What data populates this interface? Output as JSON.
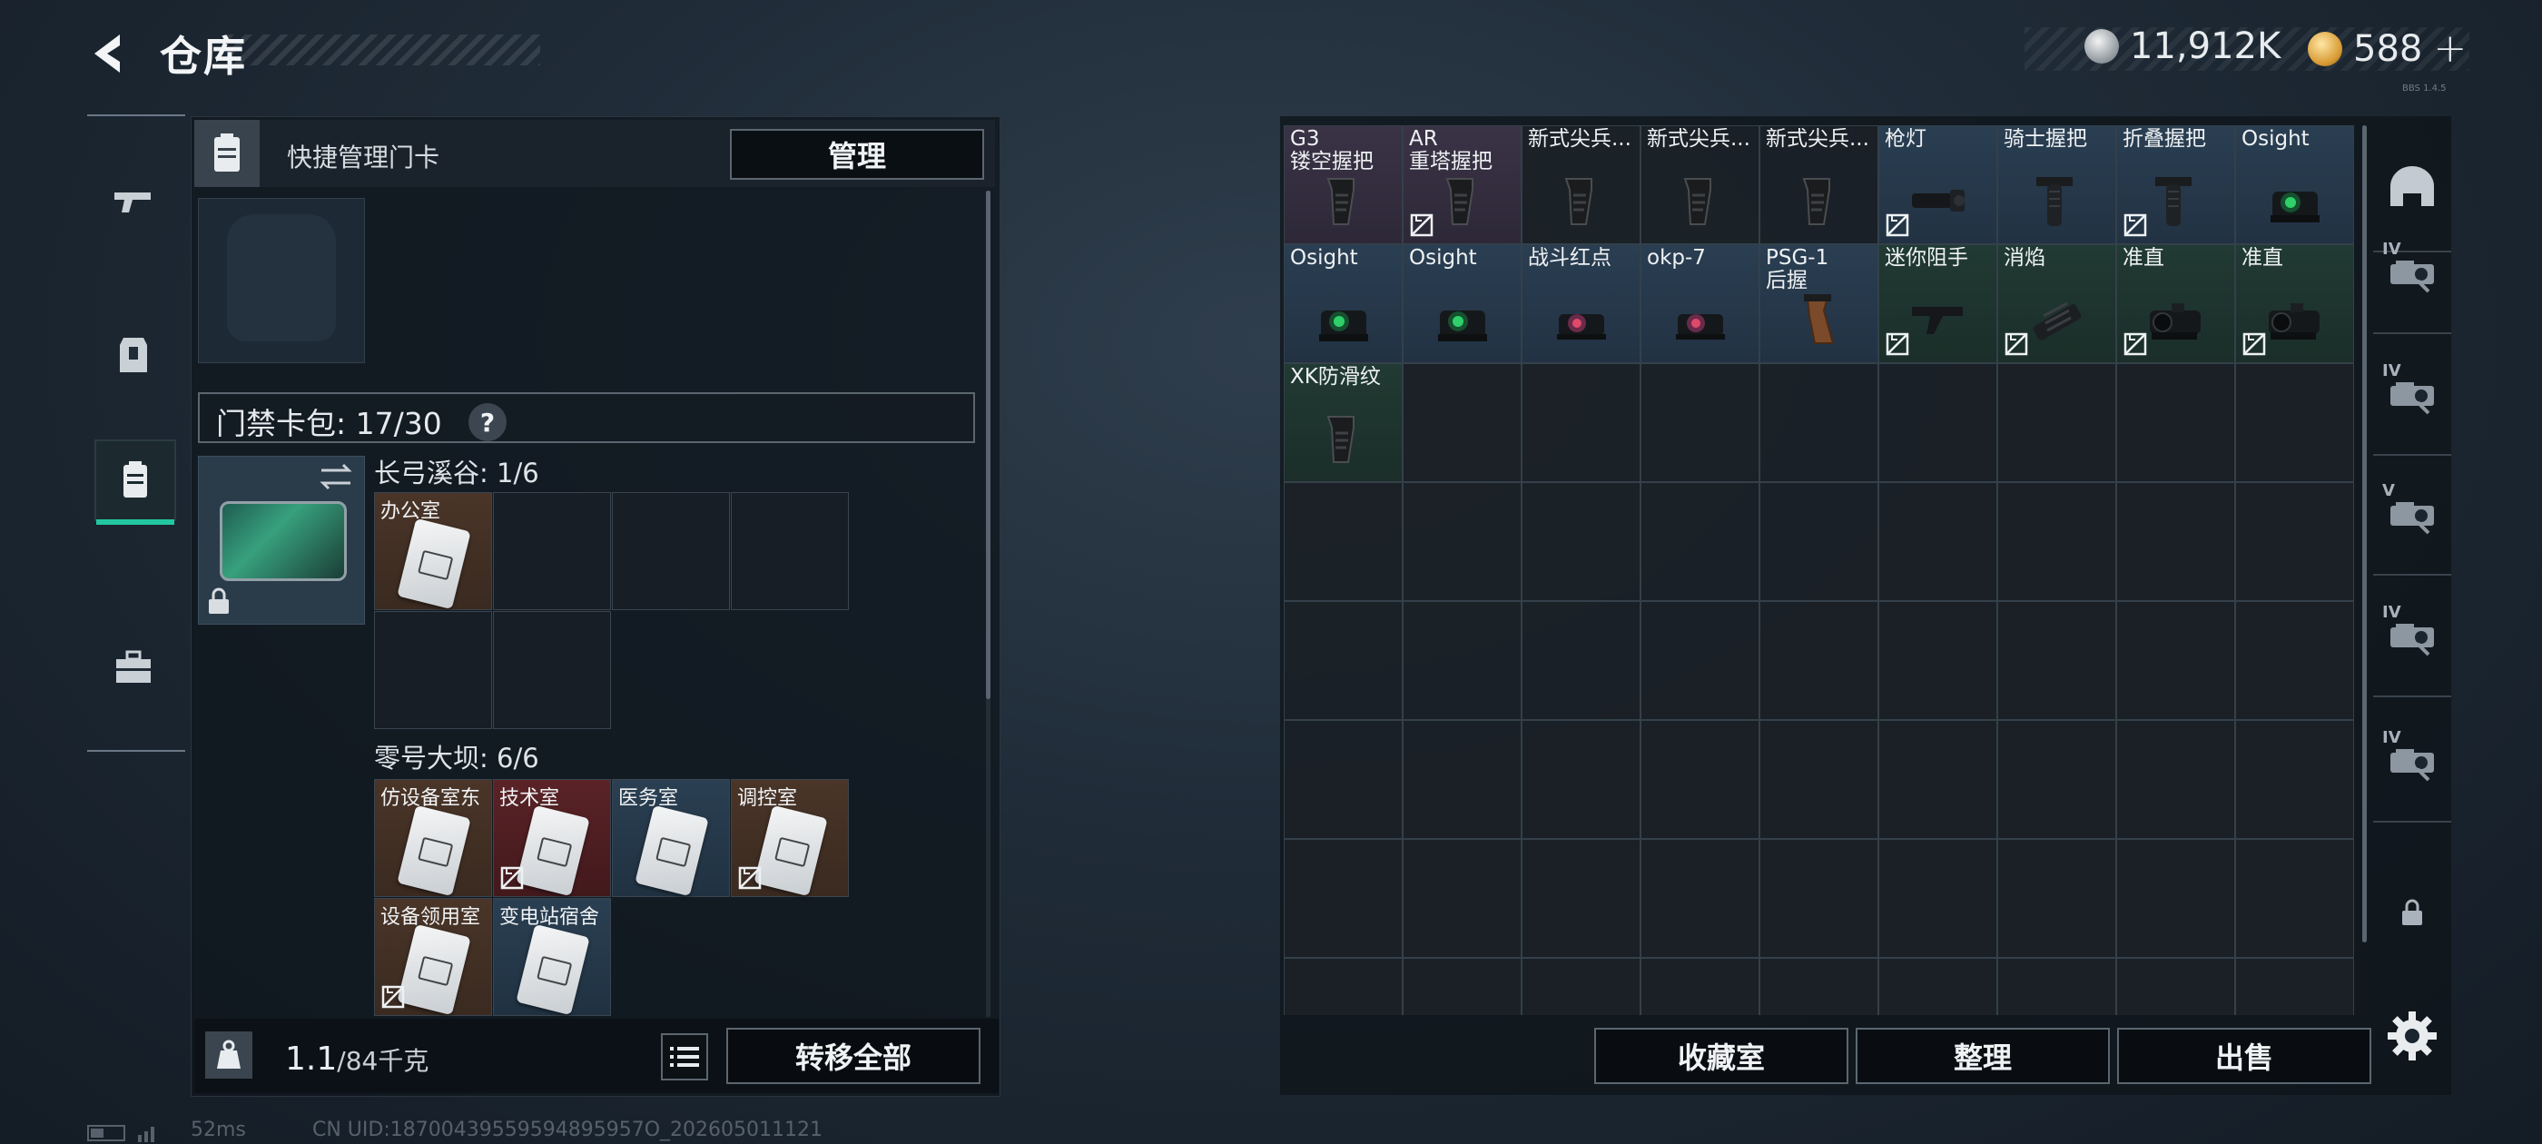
{
  "header": {
    "title": "仓库",
    "currency": [
      {
        "icon": "silver-coin-icon",
        "value": "11,912K"
      },
      {
        "icon": "gold-coin-icon",
        "value": "588",
        "suffix": "+"
      }
    ]
  },
  "left_nav": [
    {
      "icon": "gun-icon",
      "active": false
    },
    {
      "icon": "armor-icon",
      "active": false
    },
    {
      "icon": "keycard-bag-icon",
      "active": true
    },
    {
      "icon": "toolbox-icon",
      "active": false
    }
  ],
  "left_panel": {
    "quick_manage_label": "快捷管理门卡",
    "manage_button": "管理",
    "card_pack_label": "门禁卡包: 17/30",
    "help": "?",
    "sections": [
      {
        "title": "长弓溪谷: 1/6",
        "slots": [
          {
            "label": "办公室",
            "color": "brown",
            "has_card": true,
            "non_tradeable": false
          },
          {
            "label": "",
            "color": "empty"
          },
          {
            "label": "",
            "color": "empty"
          },
          {
            "label": "",
            "color": "empty"
          },
          {
            "label": "",
            "color": "empty"
          },
          {
            "label": "",
            "color": "empty"
          }
        ]
      },
      {
        "title": "零号大坝: 6/6",
        "slots": [
          {
            "label": "仿设备室东",
            "color": "brown",
            "has_card": true,
            "non_tradeable": false
          },
          {
            "label": "技术室",
            "color": "red",
            "has_card": true,
            "non_tradeable": true
          },
          {
            "label": "医务室",
            "color": "blue",
            "has_card": true,
            "non_tradeable": false
          },
          {
            "label": "调控室",
            "color": "brown",
            "has_card": true,
            "non_tradeable": true
          },
          {
            "label": "设备领用室",
            "color": "brown",
            "has_card": true,
            "non_tradeable": true
          },
          {
            "label": "变电站宿舍",
            "color": "blue",
            "has_card": true,
            "non_tradeable": false
          }
        ]
      }
    ],
    "weight_value": "1.1",
    "weight_max": "/84千克",
    "transfer_all_button": "转移全部"
  },
  "right_panel": {
    "items": [
      {
        "label": "G3\n镂空握把",
        "color": "purple",
        "kind": "grip",
        "non_tradeable": false
      },
      {
        "label": "AR\n重塔握把",
        "color": "purple",
        "kind": "grip",
        "non_tradeable": true
      },
      {
        "label": "新式尖兵...",
        "color": "empty",
        "kind": "grip",
        "non_tradeable": false
      },
      {
        "label": "新式尖兵...",
        "color": "empty",
        "kind": "grip",
        "non_tradeable": false
      },
      {
        "label": "新式尖兵...",
        "color": "empty",
        "kind": "grip",
        "non_tradeable": false
      },
      {
        "label": "枪灯",
        "color": "blue",
        "kind": "light",
        "non_tradeable": true
      },
      {
        "label": "骑士握把",
        "color": "blue",
        "kind": "vgrip",
        "non_tradeable": false
      },
      {
        "label": "折叠握把",
        "color": "blue",
        "kind": "vgrip",
        "non_tradeable": true
      },
      {
        "label": "Osight",
        "color": "blue",
        "kind": "sight",
        "non_tradeable": false
      },
      {
        "label": "Osight",
        "color": "blue",
        "kind": "sight",
        "non_tradeable": false
      },
      {
        "label": "Osight",
        "color": "blue",
        "kind": "sight",
        "non_tradeable": false
      },
      {
        "label": "战斗红点",
        "color": "blue",
        "kind": "reddot",
        "non_tradeable": false
      },
      {
        "label": "okp-7",
        "color": "blue",
        "kind": "reddot",
        "non_tradeable": false
      },
      {
        "label": "PSG-1\n后握",
        "color": "blue",
        "kind": "wood",
        "non_tradeable": false
      },
      {
        "label": "迷你阻手",
        "color": "green",
        "kind": "handstop",
        "non_tradeable": true
      },
      {
        "label": "消焰",
        "color": "green",
        "kind": "muzzle",
        "non_tradeable": true
      },
      {
        "label": "准直",
        "color": "green",
        "kind": "scope",
        "non_tradeable": true
      },
      {
        "label": "准直",
        "color": "green",
        "kind": "scope",
        "non_tradeable": true
      },
      {
        "label": "XK防滑纹",
        "color": "green",
        "kind": "grip",
        "non_tradeable": false
      }
    ],
    "storage_button": "收藏室",
    "sort_button": "整理",
    "sell_button": "出售"
  },
  "right_sidebar": [
    {
      "icon": "helmet-icon",
      "tier": ""
    },
    {
      "icon": "gun-case-icon",
      "tier": "IV"
    },
    {
      "icon": "gun-case-icon",
      "tier": "IV"
    },
    {
      "icon": "gun-case-icon",
      "tier": "V"
    },
    {
      "icon": "gun-case-icon",
      "tier": "IV"
    },
    {
      "icon": "gun-case-icon",
      "tier": "IV"
    },
    {
      "icon": "lock-icon",
      "tier": ""
    }
  ],
  "status_bar": {
    "ping": "52ms",
    "uid": "CN UID:18700439559594895957O_202605011121"
  },
  "version": "BBS 1.4.5"
}
